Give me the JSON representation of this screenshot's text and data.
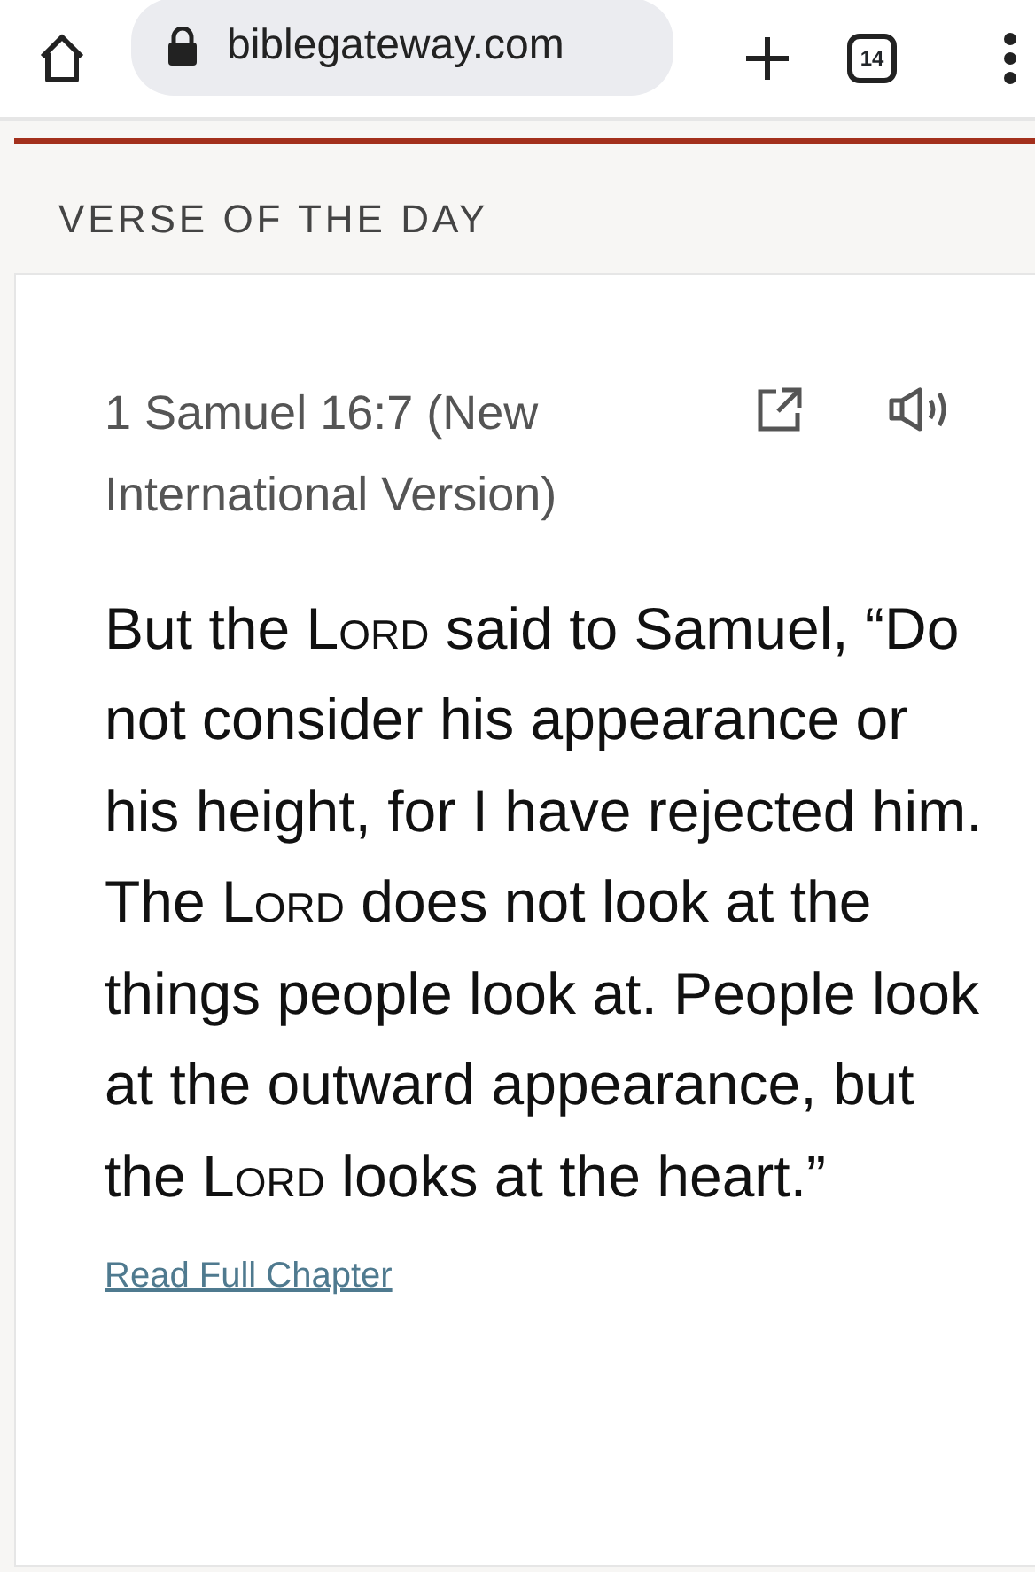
{
  "browser": {
    "url": "biblegateway.com",
    "tab_count": "14"
  },
  "section_title": "VERSE OF THE DAY",
  "reference": "1 Samuel 16:7 (New International Version)",
  "verse": [
    {
      "kind": "plain",
      "text": "But the "
    },
    {
      "kind": "small-caps",
      "text": "Lord"
    },
    {
      "kind": "plain",
      "text": " said to Samuel, “Do not consider his appearance or his height, for I have rejected him. The "
    },
    {
      "kind": "small-caps",
      "text": "Lord"
    },
    {
      "kind": "plain",
      "text": " does not look at the things people look at. People look at the outward appearance, but the "
    },
    {
      "kind": "small-caps",
      "text": "Lord"
    },
    {
      "kind": "plain",
      "text": " looks at the heart.”"
    }
  ],
  "link": "Read Full Chapter"
}
